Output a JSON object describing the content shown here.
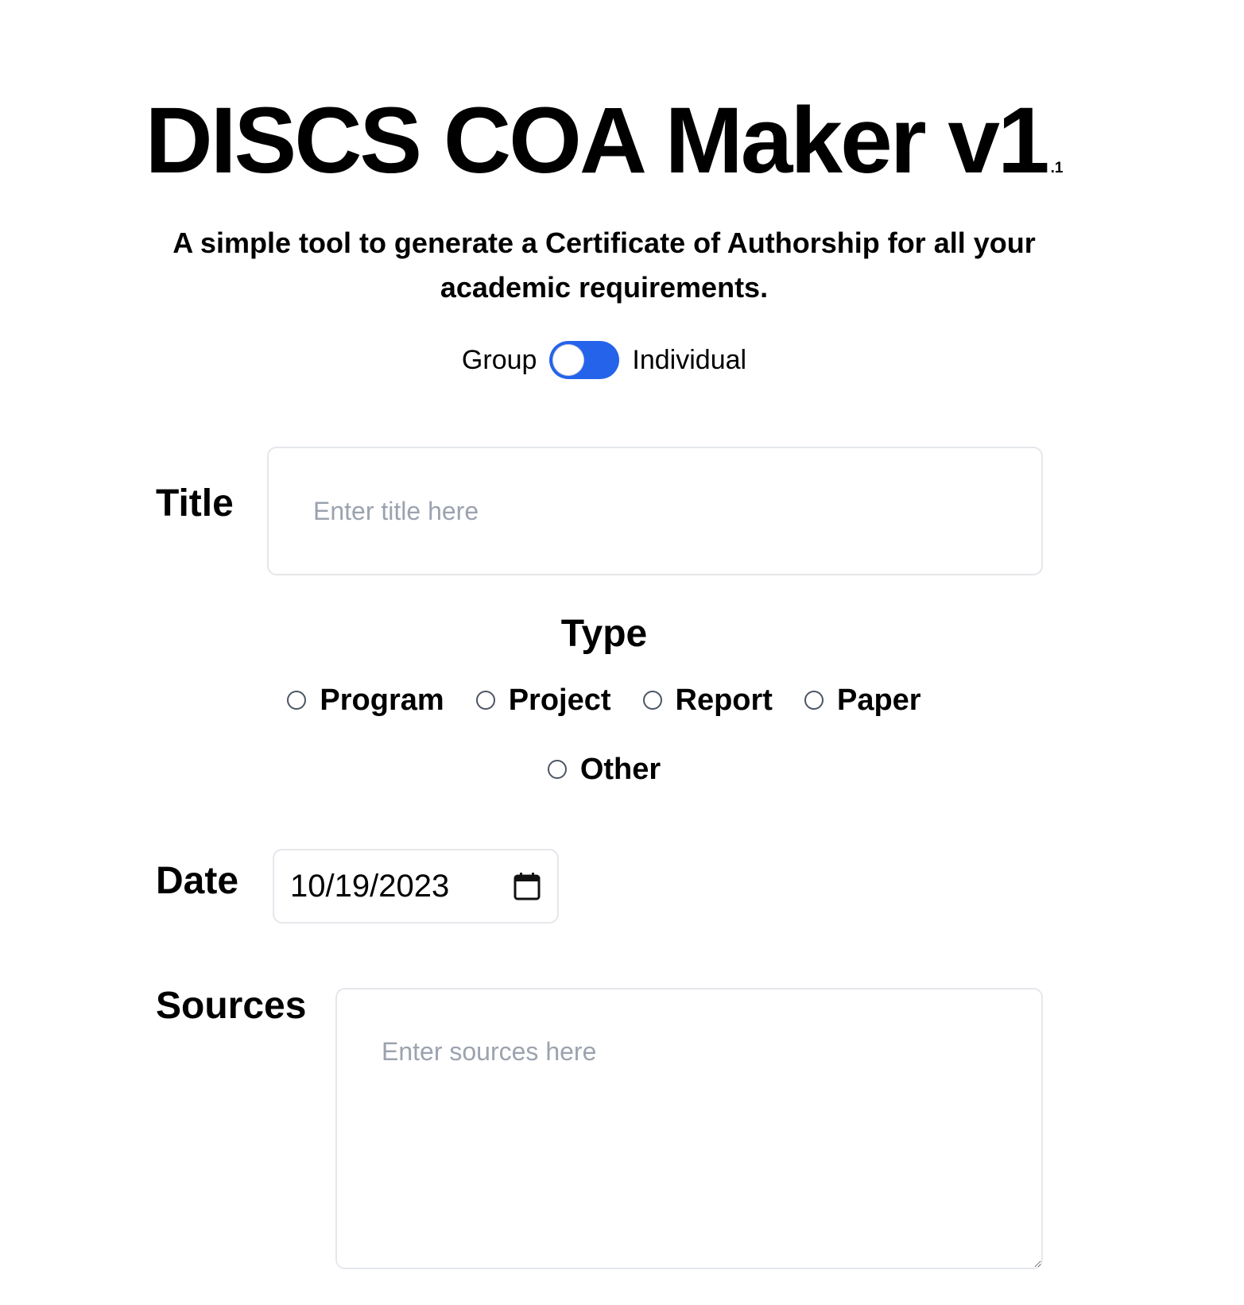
{
  "header": {
    "title": "DISCS COA Maker v1",
    "version_suffix": ".1",
    "subtitle": "A simple tool to generate a Certificate of Authorship for all your academic requirements."
  },
  "mode_toggle": {
    "left_label": "Group",
    "right_label": "Individual",
    "accent_color": "#2563eb"
  },
  "form": {
    "title": {
      "label": "Title",
      "placeholder": "Enter title here",
      "value": ""
    },
    "type": {
      "heading": "Type",
      "options": [
        "Program",
        "Project",
        "Report",
        "Paper",
        "Other"
      ],
      "selected": null
    },
    "date": {
      "label": "Date",
      "value": "10/19/2023",
      "icon": "calendar-icon"
    },
    "sources": {
      "label": "Sources",
      "placeholder": "Enter sources here",
      "value": ""
    }
  }
}
